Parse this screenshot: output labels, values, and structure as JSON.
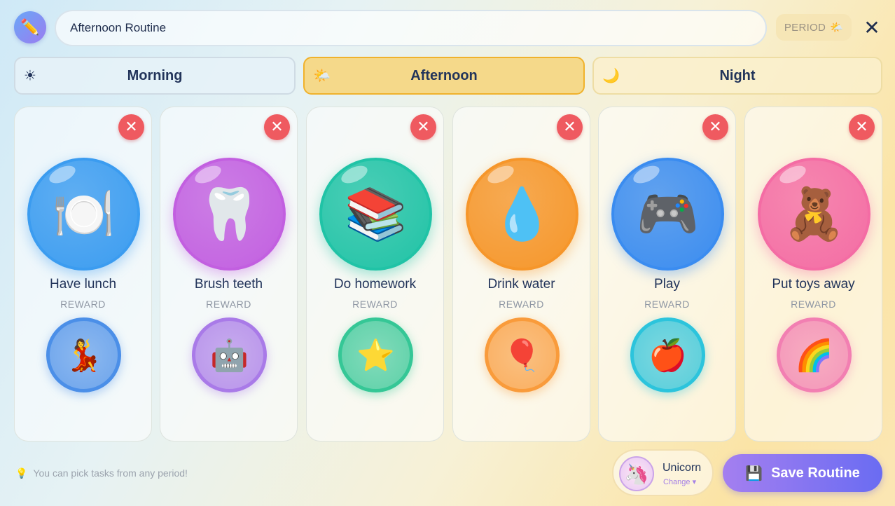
{
  "header": {
    "edit_icon": "pencil-icon",
    "title_value": "Afternoon Routine",
    "period_label": "PERIOD",
    "period_icon": "🌤️",
    "close_icon": "✕"
  },
  "tabs": [
    {
      "label": "Morning",
      "icon": "☀",
      "active": false
    },
    {
      "label": "Afternoon",
      "icon": "🌤️",
      "active": true
    },
    {
      "label": "Night",
      "icon": "🌙",
      "active": false
    }
  ],
  "tasks": [
    {
      "name": "Have lunch",
      "icon": "🍽️",
      "reward_label": "REWARD",
      "reward_icon": "💃",
      "color": "#3b9cf0",
      "reward_color": "#4b8fe8"
    },
    {
      "name": "Brush teeth",
      "icon": "🦷",
      "reward_label": "REWARD",
      "reward_icon": "🤖",
      "color": "#c25fe0",
      "reward_color": "#a97ae8"
    },
    {
      "name": "Do homework",
      "icon": "📚",
      "reward_label": "REWARD",
      "reward_icon": "⭐",
      "color": "#20c3a6",
      "reward_color": "#35c796"
    },
    {
      "name": "Drink water",
      "icon": "💧",
      "reward_label": "REWARD",
      "reward_icon": "🎈",
      "color": "#f6962a",
      "reward_color": "#f99b3b"
    },
    {
      "name": "Play",
      "icon": "🎮",
      "reward_label": "REWARD",
      "reward_icon": "🍎",
      "color": "#3a8cf0",
      "reward_color": "#2cc4dc"
    },
    {
      "name": "Put toys away",
      "icon": "🧸",
      "reward_label": "REWARD",
      "reward_icon": "🌈",
      "color": "#f46ca4",
      "reward_color": "#f27fb2"
    }
  ],
  "footer": {
    "tip_icon": "💡",
    "tip_text": "You can pick tasks from any period!",
    "pet_name": "Unicorn",
    "pet_change": "Change ▾",
    "pet_icon": "🦄",
    "save_icon": "💾",
    "save_label": "Save Routine"
  }
}
